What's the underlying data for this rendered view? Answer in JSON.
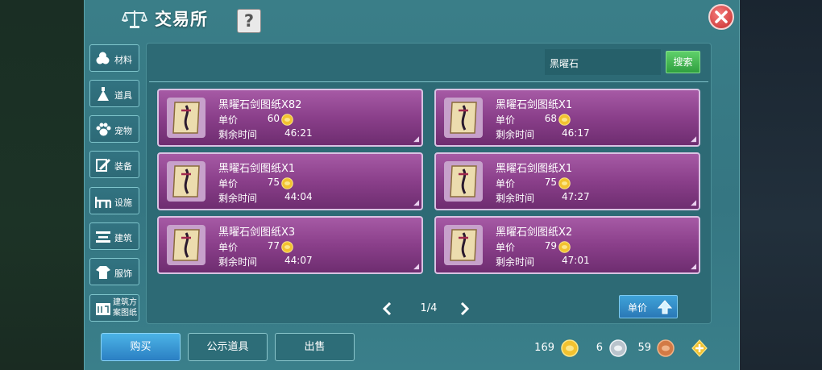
{
  "header": {
    "title": "交易所",
    "help_label": "?"
  },
  "sidebar": {
    "items": [
      {
        "label": "材料",
        "icon": "materials-icon"
      },
      {
        "label": "道具",
        "icon": "item-icon"
      },
      {
        "label": "宠物",
        "icon": "paw-icon"
      },
      {
        "label": "装备",
        "icon": "equipment-icon"
      },
      {
        "label": "设施",
        "icon": "facility-icon"
      },
      {
        "label": "建筑",
        "icon": "building-icon"
      },
      {
        "label": "服饰",
        "icon": "clothing-icon"
      },
      {
        "label": "建筑方案图纸",
        "icon": "blueprint-icon"
      }
    ]
  },
  "search": {
    "value": "黑曜石",
    "button_label": "搜索"
  },
  "listings": {
    "price_label": "单价",
    "time_label": "剩余时间",
    "items": [
      {
        "name": "黑曜石剑图纸X82",
        "price": "60",
        "time": "46:21"
      },
      {
        "name": "黑曜石剑图纸X1",
        "price": "68",
        "time": "46:17"
      },
      {
        "name": "黑曜石剑图纸X1",
        "price": "75",
        "time": "44:04"
      },
      {
        "name": "黑曜石剑图纸X1",
        "price": "75",
        "time": "47:27"
      },
      {
        "name": "黑曜石剑图纸X3",
        "price": "77",
        "time": "44:07"
      },
      {
        "name": "黑曜石剑图纸X2",
        "price": "79",
        "time": "47:01"
      }
    ]
  },
  "pagination": {
    "text": "1/4"
  },
  "sort": {
    "label": "单价"
  },
  "actions": {
    "buy": "购买",
    "publish": "公示道具",
    "sell": "出售"
  },
  "currency": {
    "gold": "169",
    "silver": "6",
    "copper": "59"
  },
  "colors": {
    "card_purple": "#8a3f8a",
    "panel_teal": "#357682",
    "accent_blue": "#2b7fc3",
    "search_green": "#2f9f3f"
  }
}
